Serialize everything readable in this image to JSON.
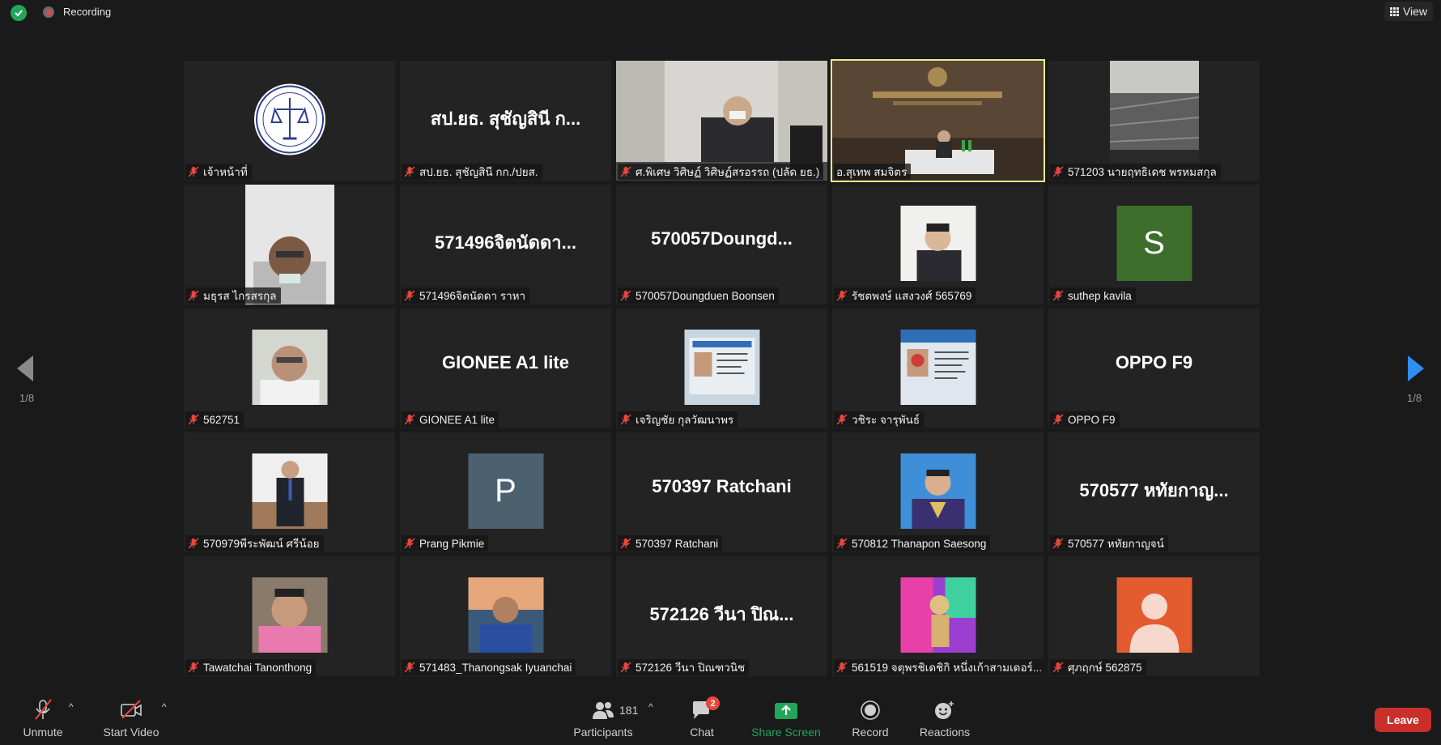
{
  "topbar": {
    "recording_label": "Recording",
    "view_label": "View"
  },
  "gallery": {
    "page_indicator_left": "1/8",
    "page_indicator_right": "1/8",
    "tiles": [
      {
        "name": "เจ้าหน้าที่",
        "big": ""
      },
      {
        "name": "สป.ยธ. สุชัญสินี กก./ปยส.",
        "big": "สป.ยธ. สุชัญสินี ก..."
      },
      {
        "name": "ศ.พิเศษ วิศิษฏ์ วิศิษฏ์สรอรรถ (ปลัด ยธ.)",
        "big": ""
      },
      {
        "name": "อ.สุเทพ  สมจิตร",
        "big": "",
        "active": true
      },
      {
        "name": "571203 นายฤทธิเดช พรหมสกุล",
        "big": ""
      },
      {
        "name": "มธุรส ไกรสรกุล",
        "big": ""
      },
      {
        "name": "571496จิตนัดดา ราหา",
        "big": "571496จิตนัดดา..."
      },
      {
        "name": "570057Doungduen Boonsen",
        "big": "570057Doungd..."
      },
      {
        "name": "รัชตพงษ์ แสงวงศ์ 565769",
        "big": ""
      },
      {
        "name": "suthep kavila",
        "big": "",
        "avatar_letter": "S",
        "avatar_color": "#3d6e2b"
      },
      {
        "name": "562751",
        "big": ""
      },
      {
        "name": "GIONEE A1 lite",
        "big": "GIONEE A1 lite"
      },
      {
        "name": "เจริญชัย กุลวัฒนาพร",
        "big": ""
      },
      {
        "name": "วชิระ จารุพันธ์",
        "big": ""
      },
      {
        "name": "OPPO F9",
        "big": "OPPO F9"
      },
      {
        "name": "570979พีระพัฒน์ ศรีน้อย",
        "big": ""
      },
      {
        "name": "Prang Pikmie",
        "big": "",
        "avatar_letter": "P",
        "avatar_color": "#4b6170"
      },
      {
        "name": "570397 Ratchani",
        "big": "570397 Ratchani"
      },
      {
        "name": "570812 Thanapon Saesong",
        "big": ""
      },
      {
        "name": "570577 หทัยกาญจน์",
        "big": "570577 หทัยกาญ..."
      },
      {
        "name": "Tawatchai Tanonthong",
        "big": ""
      },
      {
        "name": "571483_Thanongsak Iyuanchai",
        "big": ""
      },
      {
        "name": "572126 วีนา ปิณฑวนิช",
        "big": "572126 วีนา ปิณ..."
      },
      {
        "name": "561519 จตุพรชิเดชิกิ หนึ่งเก้าสามเดอร์...",
        "big": ""
      },
      {
        "name": "ศุภฤกษ์  562875",
        "big": "",
        "avatar_color": "#e35b2e"
      }
    ]
  },
  "toolbar": {
    "unmute": "Unmute",
    "start_video": "Start Video",
    "participants": "Participants",
    "participants_count": "181",
    "chat": "Chat",
    "chat_badge": "2",
    "share_screen": "Share Screen",
    "record": "Record",
    "reactions": "Reactions",
    "leave": "Leave"
  },
  "colors": {
    "share_green": "#23a55a",
    "leave_red": "#c9302c",
    "active_border": "#e4ef8f",
    "nav_blue": "#2f8ff0"
  }
}
